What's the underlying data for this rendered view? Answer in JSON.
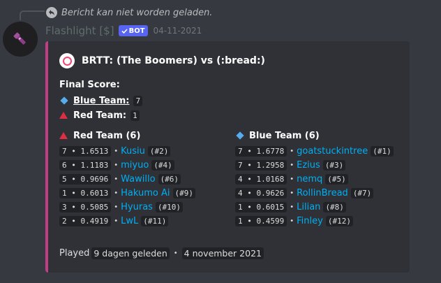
{
  "reply": {
    "text": "Bericht kan niet worden geladen."
  },
  "message": {
    "username": "Flashlight [$]",
    "bot_tag": "BOT",
    "timestamp": "04-11-2021"
  },
  "embed": {
    "accent_color": "#c13e87",
    "title": "BRTT: (The Boomers) vs (:bread:)",
    "final_score_label": "Final Score:",
    "scores": [
      {
        "team": "Blue Team:",
        "score": "7",
        "icon": "blue-diamond-icon"
      },
      {
        "team": "Red Team:",
        "score": "1",
        "icon": "red-triangle-icon"
      }
    ],
    "teams": [
      {
        "header": "Red Team (6)",
        "icon": "red-triangle-icon",
        "players": [
          {
            "stats": "7 • 1.6513",
            "name": "Kusiu",
            "rank": "(#2)"
          },
          {
            "stats": "6 • 1.1183",
            "name": "miyuo",
            "rank": "(#4)"
          },
          {
            "stats": "5 • 0.9696",
            "name": "Wawillo",
            "rank": "(#6)"
          },
          {
            "stats": "1 • 0.6013",
            "name": "Hakumo Ai",
            "rank": "(#9)"
          },
          {
            "stats": "3 • 0.5085",
            "name": "Hyuras",
            "rank": "(#10)"
          },
          {
            "stats": "2 • 0.4919",
            "name": "LwL",
            "rank": "(#11)"
          }
        ]
      },
      {
        "header": "Blue Team (6)",
        "icon": "blue-diamond-icon",
        "players": [
          {
            "stats": "7 • 1.6778",
            "name": "goatstuckintree",
            "rank": "(#1)"
          },
          {
            "stats": "7 • 1.2958",
            "name": "Ezius",
            "rank": "(#3)"
          },
          {
            "stats": "4 • 1.0168",
            "name": "nemq",
            "rank": "(#5)"
          },
          {
            "stats": "4 • 0.9626",
            "name": "RollinBread",
            "rank": "(#7)"
          },
          {
            "stats": "1 • 0.6015",
            "name": "Lilian",
            "rank": "(#8)"
          },
          {
            "stats": "1 • 0.4599",
            "name": "Finley",
            "rank": "(#12)"
          }
        ]
      }
    ],
    "footer": {
      "played_label": "Played",
      "relative": "9 dagen geleden",
      "separator": "•",
      "date": "4 november 2021"
    }
  }
}
